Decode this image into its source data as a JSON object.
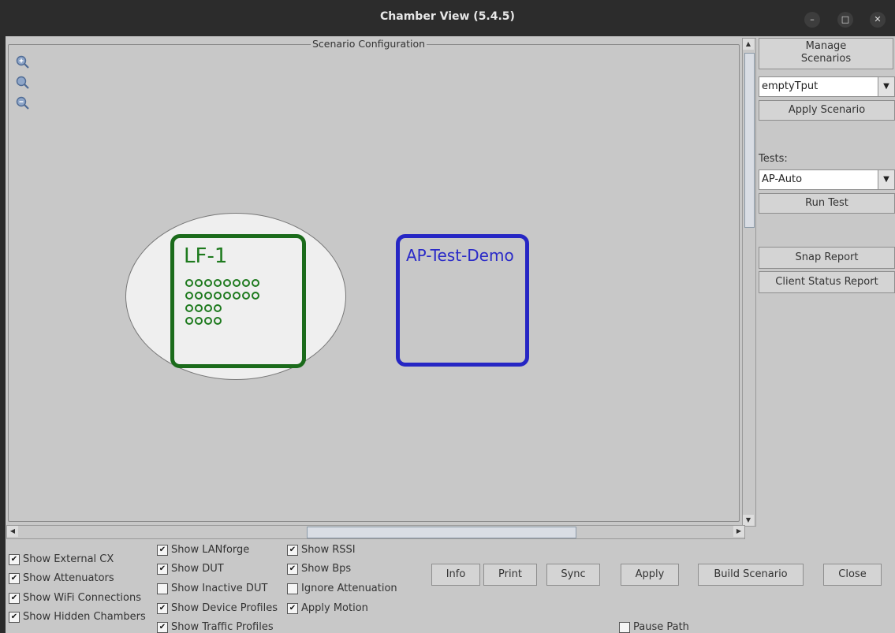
{
  "window": {
    "title": "Chamber View (5.4.5)",
    "minimize_glyph": "–",
    "maximize_glyph": "□",
    "close_glyph": "✕"
  },
  "canvas": {
    "legend": "Scenario Configuration",
    "nodes": [
      {
        "name": "LF-1",
        "color": "#1e7a1e",
        "dot_rows": [
          8,
          8,
          4,
          4
        ]
      },
      {
        "name": "AP-Test-Demo",
        "color": "#2a2ac8"
      }
    ]
  },
  "right_panel": {
    "manage_scenarios": "Manage\nScenarios",
    "scenario_select": "emptyTput",
    "apply_scenario": "Apply Scenario",
    "tests_label": "Tests:",
    "test_select": "AP-Auto",
    "run_test": "Run Test",
    "snap_report": "Snap Report",
    "client_status_report": "Client Status Report"
  },
  "checkboxes": {
    "show_external_cx": {
      "label": "Show External CX",
      "checked": true
    },
    "show_attenuators": {
      "label": "Show Attenuators",
      "checked": true
    },
    "show_wifi_connections": {
      "label": "Show WiFi Connections",
      "checked": true
    },
    "show_hidden_chambers": {
      "label": "Show Hidden Chambers",
      "checked": true
    },
    "show_lanforge": {
      "label": "Show LANforge",
      "checked": true
    },
    "show_dut": {
      "label": "Show DUT",
      "checked": true
    },
    "show_inactive_dut": {
      "label": "Show Inactive DUT",
      "checked": false
    },
    "show_device_profiles": {
      "label": "Show Device Profiles",
      "checked": true
    },
    "show_traffic_profiles": {
      "label": "Show Traffic Profiles",
      "checked": true
    },
    "show_rssi": {
      "label": "Show RSSI",
      "checked": true
    },
    "show_bps": {
      "label": "Show Bps",
      "checked": true
    },
    "ignore_attenuation": {
      "label": "Ignore Attenuation",
      "checked": false
    },
    "apply_motion": {
      "label": "Apply Motion",
      "checked": true
    },
    "pause_path": {
      "label": "Pause Path",
      "checked": false
    }
  },
  "buttons": {
    "info": "Info",
    "print": "Print",
    "sync": "Sync",
    "apply": "Apply",
    "build_scenario": "Build Scenario",
    "close": "Close"
  },
  "check_glyph": "✔"
}
